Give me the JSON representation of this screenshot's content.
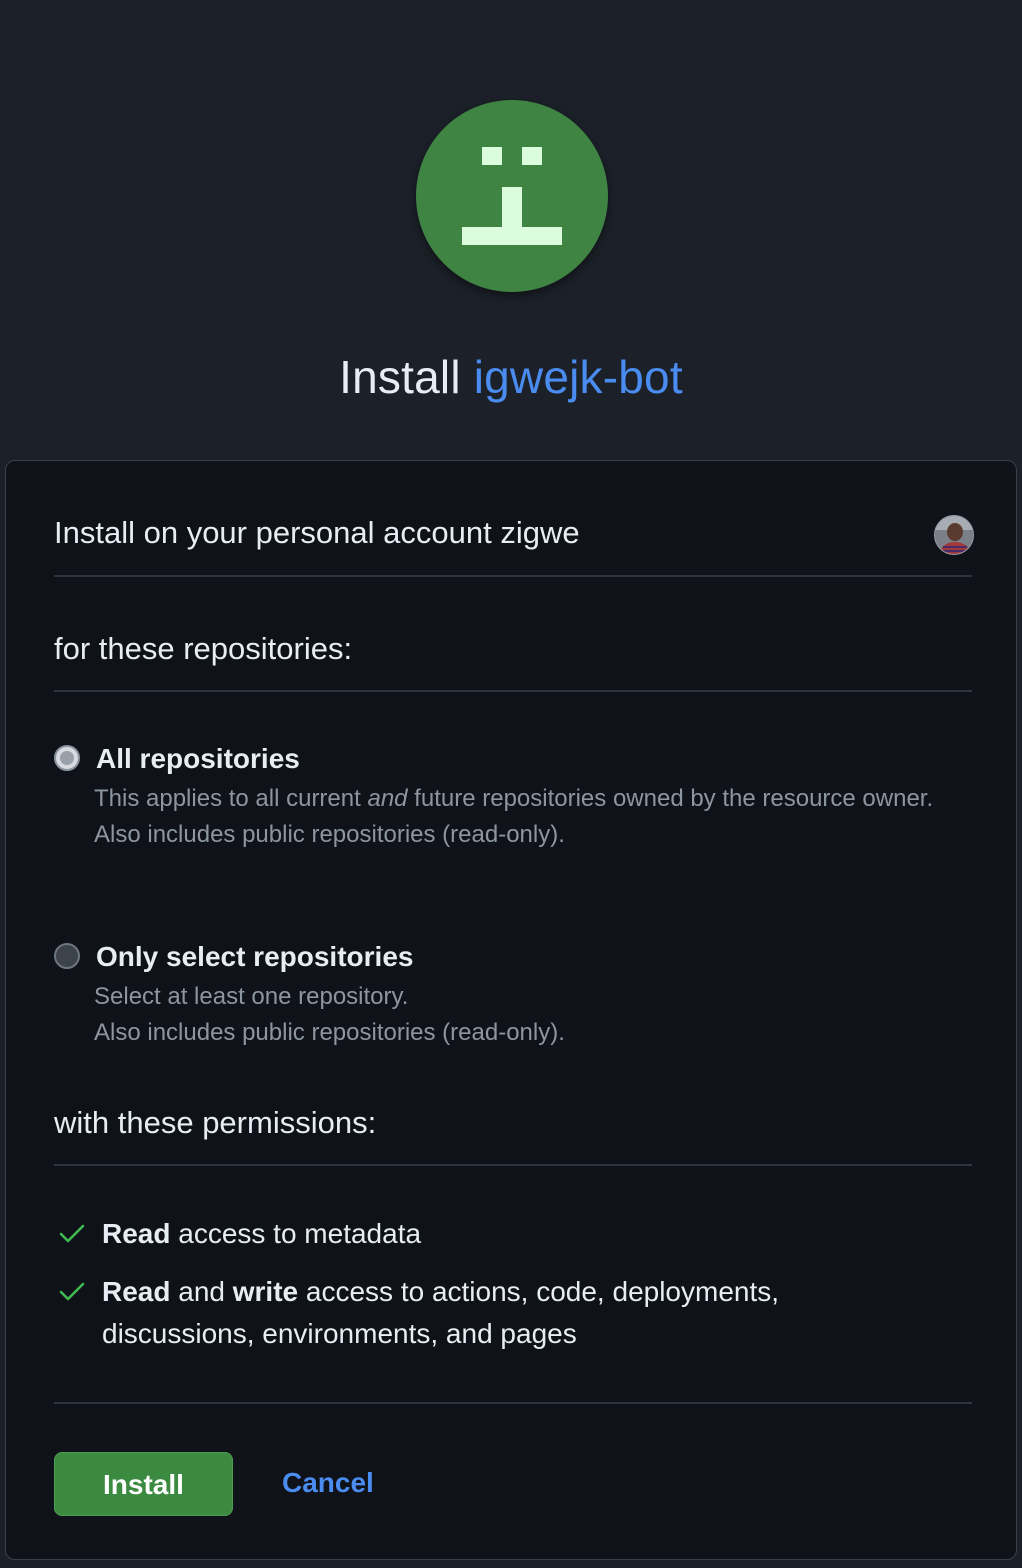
{
  "header": {
    "title_prefix": "Install",
    "app_name": "igwejk-bot"
  },
  "account": {
    "text": "Install on your personal account zigwe"
  },
  "repositories": {
    "heading": "for these repositories:",
    "options": [
      {
        "label": "All repositories",
        "desc_part1": "This applies to all current ",
        "desc_emphasis": "and",
        "desc_part2": " future repositories owned by the resource owner.",
        "desc_line2": "Also includes public repositories (read-only).",
        "selected": true
      },
      {
        "label": "Only select repositories",
        "desc_line1": "Select at least one repository.",
        "desc_line2": "Also includes public repositories (read-only).",
        "selected": false
      }
    ]
  },
  "permissions": {
    "heading": "with these permissions:",
    "items": [
      {
        "bold1": "Read",
        "rest": " access to metadata"
      },
      {
        "bold1": "Read",
        "mid": " and ",
        "bold2": "write",
        "rest": " access to actions, code, deployments, discussions, environments, and pages"
      }
    ]
  },
  "actions": {
    "install_label": "Install",
    "cancel_label": "Cancel"
  },
  "colors": {
    "accent_green": "#3b8a40",
    "link_blue": "#4a8cf0",
    "avatar_bg": "#3f8443",
    "check_green": "#3fb950"
  },
  "icons": {
    "app_avatar": "identicon",
    "permission_check": "check-icon"
  }
}
